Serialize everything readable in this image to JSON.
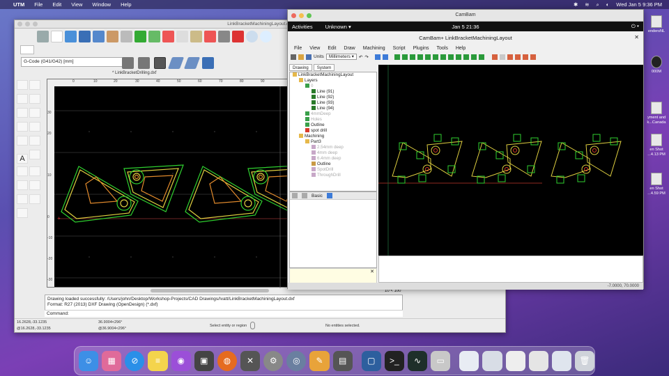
{
  "menubar": {
    "app": "UTM",
    "items": [
      "File",
      "Edit",
      "View",
      "Window",
      "Help"
    ],
    "clock": "Wed Jan 5  9:36 PM"
  },
  "desktop_icons": [
    {
      "label": "endersNL"
    },
    {
      "label": "000M"
    },
    {
      "label": "yment and\nk...Canada"
    },
    {
      "label": "en Shot\n...4.13 PM"
    },
    {
      "label": "en Shot\n...4.59 PM"
    }
  ],
  "utm": {
    "title": "LinkBracketMachiningLayout.dxf",
    "gcode_label": "G-Code (G41/G42) [mm]",
    "doc_tab": "* LinkBracketDrilling.dxf",
    "ruler_top": [
      "0",
      "10",
      "20",
      "30",
      "40",
      "50",
      "60",
      "70",
      "80",
      "90"
    ],
    "ruler_left": [
      "30",
      "20",
      "10",
      "0",
      "-10",
      "-20",
      "-30"
    ],
    "zoom": "10 < 100",
    "log_line1": "Drawing loaded successfully: /Users/john/Desktop/Workshop-Projects/CAD Drawings/Ivatt/LinkBracketMachiningLayout.dxf",
    "log_line2": "Format: R27 (2013) DXF Drawing (OpenDesign) (*.dxf)",
    "command_label": "Command:",
    "status": {
      "abs": "16.2628,-33.1235",
      "rel": "@16.2628,-33.1235",
      "polar": "36.9004<296°",
      "polar_rel": "@36.9004<296°",
      "hint": "Select entity or region",
      "sel": "No entities selected."
    }
  },
  "vm": {
    "title": "CamBam",
    "activities": "Activities",
    "unknown": "Unknown",
    "clock": "Jan 5  21:36",
    "cambam_title": "CamBam+ LinkBracketMachiningLayout",
    "menu": [
      "File",
      "View",
      "Edit",
      "Draw",
      "Machining",
      "Script",
      "Plugins",
      "Tools",
      "Help"
    ],
    "units_label": "Units",
    "units_value": "Millimeters",
    "tabs": [
      "Drawing",
      "System"
    ],
    "tree": [
      {
        "text": "LinkBracketMachiningLayout",
        "indent": 0,
        "icon": "folder",
        "dim": false
      },
      {
        "text": "Layers",
        "indent": 1,
        "icon": "folder",
        "dim": false
      },
      {
        "text": "0",
        "indent": 2,
        "icon": "layer",
        "dim": true
      },
      {
        "text": "Line (91)",
        "indent": 3,
        "icon": "line",
        "dim": false
      },
      {
        "text": "Line (92)",
        "indent": 3,
        "icon": "line",
        "dim": false
      },
      {
        "text": "Line (93)",
        "indent": 3,
        "icon": "line",
        "dim": false
      },
      {
        "text": "Line (94)",
        "indent": 3,
        "icon": "line",
        "dim": false
      },
      {
        "text": "4mmDeep",
        "indent": 2,
        "icon": "layer",
        "dim": true
      },
      {
        "text": "Holes",
        "indent": 2,
        "icon": "layer",
        "dim": true
      },
      {
        "text": "Outline",
        "indent": 2,
        "icon": "layer",
        "dim": false
      },
      {
        "text": "spot drill",
        "indent": 2,
        "icon": "red",
        "dim": false
      },
      {
        "text": "Machining",
        "indent": 1,
        "icon": "folder",
        "dim": false
      },
      {
        "text": "Part3",
        "indent": 2,
        "icon": "folder",
        "dim": false
      },
      {
        "text": "2.54mm deep",
        "indent": 3,
        "icon": "op",
        "dim": true
      },
      {
        "text": "4mm deep",
        "indent": 3,
        "icon": "op",
        "dim": true
      },
      {
        "text": "6.4mm deep",
        "indent": 3,
        "icon": "op",
        "dim": true
      },
      {
        "text": "Outline",
        "indent": 3,
        "icon": "profile",
        "dim": false
      },
      {
        "text": "SpotDrill",
        "indent": 3,
        "icon": "op",
        "dim": true
      },
      {
        "text": "ThroughDrill",
        "indent": 3,
        "icon": "op",
        "dim": true
      }
    ],
    "props_tab": "Basic",
    "status_coords": "-7.0000, 70.0000"
  },
  "colors": {
    "accent_yellow": "#e0d040",
    "accent_green": "#2fd02f",
    "accent_red": "#d83a2a",
    "orange": "#e38b2c"
  }
}
